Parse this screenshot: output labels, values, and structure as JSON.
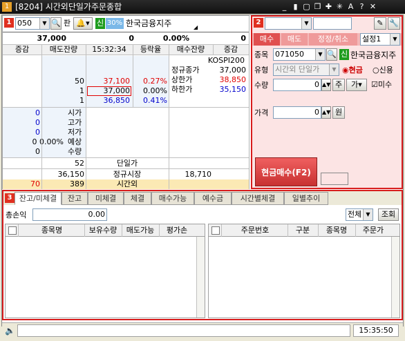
{
  "window": {
    "badge": "1",
    "title": "[8204] 시간외단일가주문종합",
    "icons": [
      "minimize-icon",
      "mouse-icon",
      "frame-icon",
      "restore-icon",
      "pin-icon",
      "star-icon",
      "font-icon",
      "help-icon",
      "close-icon"
    ]
  },
  "left_panel": {
    "badge": "1",
    "code": "050",
    "pan_label": "판",
    "credit_label": "신",
    "margin_rate": "30%",
    "stock_name": "한국금융지주",
    "summary": {
      "price": "37,000",
      "change": "0",
      "rate": "0.00%",
      "volume": "0"
    },
    "headers": {
      "c1": "증감",
      "c2": "매도잔량",
      "time": "15:32:34",
      "c4": "등락율",
      "c5": "매수잔량",
      "c6": "증감"
    },
    "ask_rows": [
      {
        "qty": "",
        "price": "",
        "rate": ""
      },
      {
        "qty": "",
        "price": "",
        "rate": ""
      },
      {
        "qty": "50",
        "price": "37,100",
        "rate": "0.27%"
      },
      {
        "qty": "1",
        "price": "37,000",
        "rate": "0.00%"
      },
      {
        "qty": "1",
        "price": "36,850",
        "rate": "0.41%"
      }
    ],
    "info": {
      "index_name": "KOSPI200",
      "prev_close_label": "정규종가",
      "prev_close": "37,000",
      "upper_label": "상한가",
      "upper": "38,850",
      "lower_label": "하한가",
      "lower": "35,150"
    },
    "ohlc_rows": [
      {
        "val": "0",
        "label": "시가"
      },
      {
        "val": "0",
        "label": "고가"
      },
      {
        "val": "0",
        "label": "저가"
      },
      {
        "val": "0 0.00%",
        "label": "예상"
      },
      {
        "val": "0",
        "label": "수량"
      }
    ],
    "bottom_rows": [
      {
        "a": "",
        "b": "52",
        "label": "단일가",
        "d": ""
      },
      {
        "a": "",
        "b": "36,150",
        "label": "정규시장",
        "d": "18,710"
      },
      {
        "a": "70",
        "b": "389",
        "label": "시간외",
        "d": ""
      }
    ]
  },
  "right_panel": {
    "badge": "2",
    "tabs": [
      "매수",
      "매도",
      "정정/취소"
    ],
    "setting": "설정1",
    "labels": {
      "stock": "종목",
      "type": "유형",
      "qty": "수량",
      "price": "가격"
    },
    "stock_code": "071050",
    "credit_label": "신",
    "stock_name": "한국금융지주",
    "order_type": "시간외 단일가",
    "radio_cash": "현금",
    "radio_credit": "신용",
    "qty_value": "0",
    "qty_unit": "주",
    "qty_btn": "가",
    "check_label": "미수",
    "price_value": "0",
    "price_unit": "원",
    "submit": "현금매수(F2)"
  },
  "bottom_panel": {
    "badge": "3",
    "tabs": [
      "잔고/미체결",
      "잔고",
      "미체결",
      "체결",
      "매수가능",
      "예수금",
      "시간별체결",
      "일별추이"
    ],
    "profit_label": "총손익",
    "profit_value": "0.00",
    "filter": "전체",
    "query_btn": "조회",
    "left_cols": [
      "종목명",
      "보유수량",
      "매도가능",
      "평가손"
    ],
    "right_cols": [
      "주문번호",
      "구분",
      "종목명",
      "주문가"
    ]
  },
  "status": {
    "time": "15:35:50"
  }
}
